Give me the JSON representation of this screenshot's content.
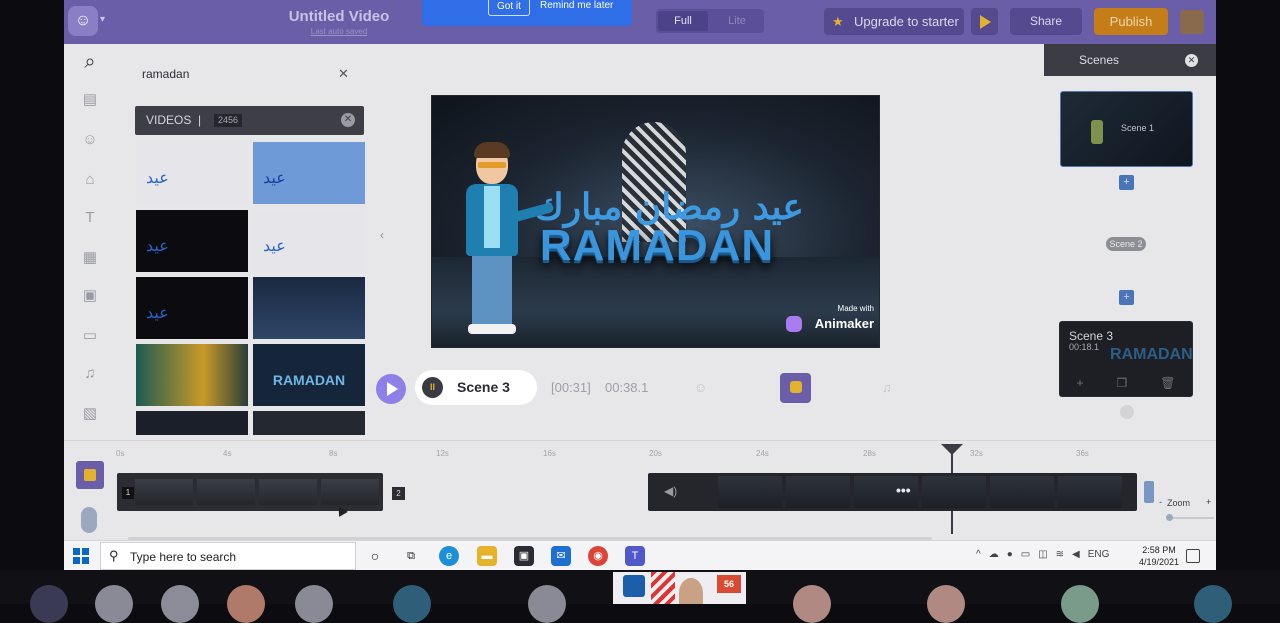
{
  "app": {
    "title": "Untitled Video",
    "subtitle": "Last auto saved",
    "banner": {
      "got_it": "Got it",
      "remind": "Remind me later"
    },
    "mode": {
      "full": "Full",
      "lite": "Lite"
    },
    "upgrade_label": "Upgrade to starter",
    "share_label": "Share",
    "publish_label": "Publish",
    "accent_color": "#6a5ea8",
    "publish_color": "#c47d18"
  },
  "library": {
    "search_value": "ramadan",
    "category": "VIDEOS",
    "count": "2456",
    "thumb_captions": [
      "",
      "",
      "",
      "",
      "",
      "",
      "",
      "RAMADAN",
      "",
      ""
    ]
  },
  "stage": {
    "arabic_text": "عيد رمضان مبارك",
    "headline": "RAMADAN",
    "made_with": "Made with",
    "brand": "Animaker"
  },
  "player": {
    "scene_label": "Scene 3",
    "current_time": "[00:31]",
    "total_time": "00:38.1"
  },
  "scenes": {
    "header": "Scenes",
    "items": [
      {
        "label": "Scene 1"
      },
      {
        "label": "Scene 2"
      },
      {
        "label": "Scene 3",
        "duration": "00:18.1"
      }
    ]
  },
  "timeline": {
    "ticks": [
      "0s",
      "4s",
      "8s",
      "12s",
      "16s",
      "20s",
      "24s",
      "28s",
      "32s",
      "36s"
    ],
    "clip1_number": "1",
    "clip2_number": "2",
    "zoom_label": "Zoom",
    "zoom_minus": "-",
    "zoom_plus": "+"
  },
  "taskbar": {
    "search_placeholder": "Type here to search",
    "language": "ENG",
    "time": "2:58 PM",
    "date": "4/19/2021"
  }
}
